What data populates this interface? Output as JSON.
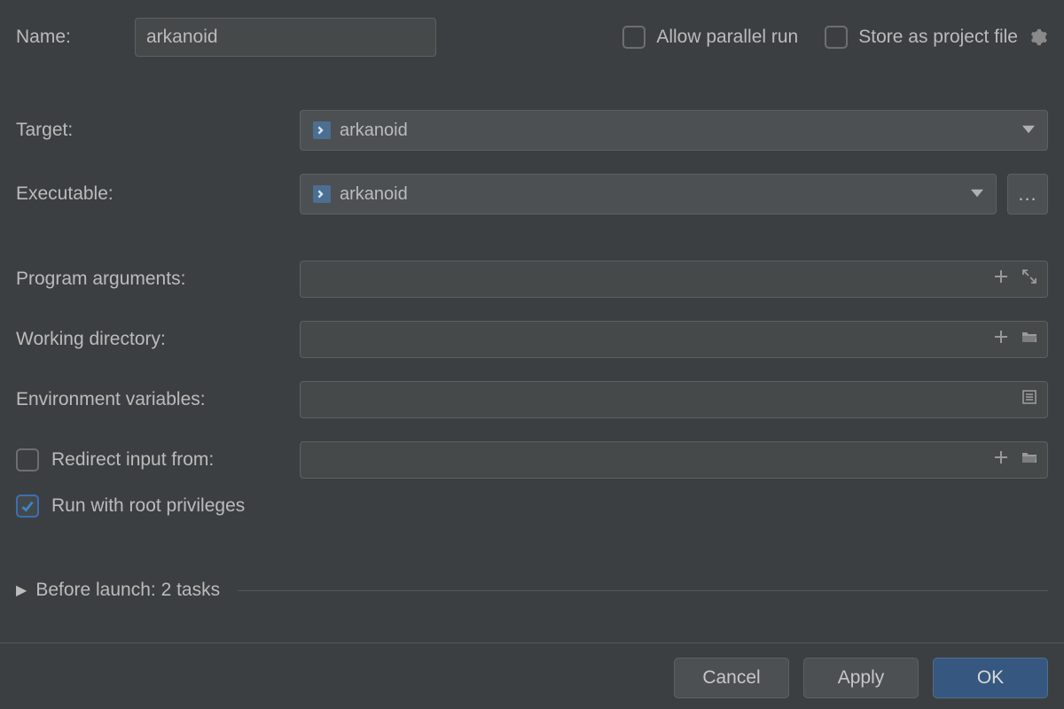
{
  "labels": {
    "name": "Name:",
    "target": "Target:",
    "executable": "Executable:",
    "program_args": "Program arguments:",
    "working_dir": "Working directory:",
    "env_vars": "Environment variables:",
    "redirect_input": "Redirect input from:",
    "root_privileges": "Run with root privileges",
    "before_launch": "Before launch: 2 tasks"
  },
  "values": {
    "name": "arkanoid",
    "target": "arkanoid",
    "executable": "arkanoid",
    "program_args": "",
    "working_dir": "",
    "env_vars": "",
    "redirect_input": ""
  },
  "checkboxes": {
    "allow_parallel": {
      "label": "Allow parallel run",
      "checked": false
    },
    "store_project": {
      "label": "Store as project file",
      "checked": false
    },
    "redirect_input": {
      "checked": false
    },
    "root": {
      "checked": true
    }
  },
  "buttons": {
    "cancel": "Cancel",
    "apply": "Apply",
    "ok": "OK",
    "ellipsis": "..."
  }
}
